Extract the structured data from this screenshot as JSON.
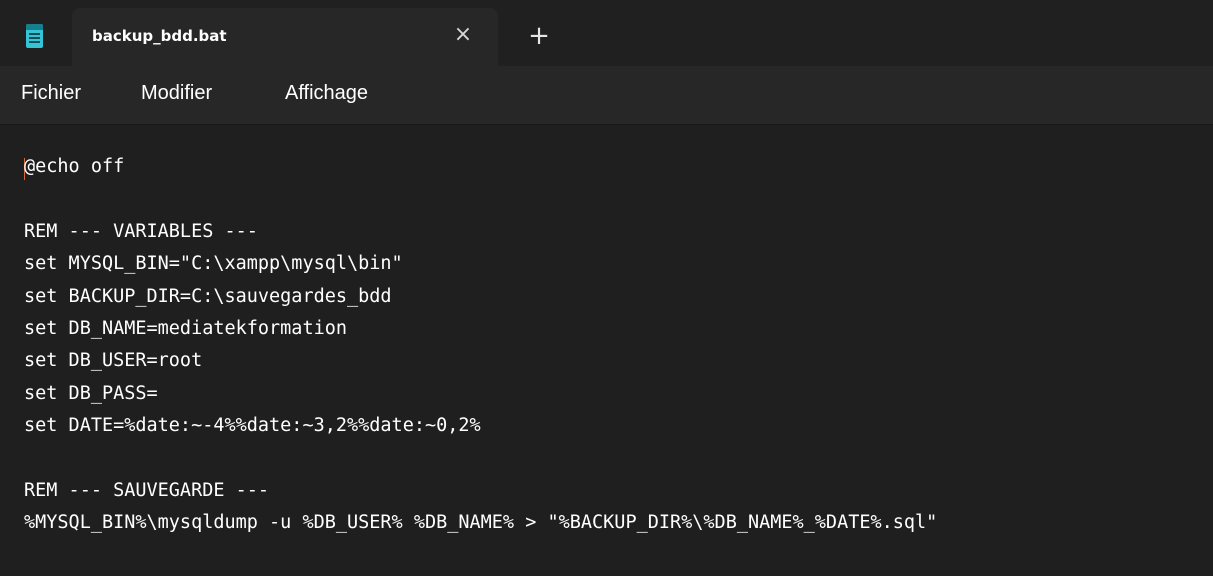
{
  "window": {
    "tab_title": "backup_bdd.bat",
    "close_glyph": "×",
    "new_tab_glyph": "+",
    "app_icon": "notepad-icon",
    "accent_color": "#35c3d6"
  },
  "menu": {
    "items": [
      "Fichier",
      "Modifier",
      "Affichage"
    ]
  },
  "editor": {
    "lines": [
      "@echo off",
      "",
      "REM --- VARIABLES ---",
      "set MYSQL_BIN=\"C:\\xampp\\mysql\\bin\"",
      "set BACKUP_DIR=C:\\sauvegardes_bdd",
      "set DB_NAME=mediatekformation",
      "set DB_USER=root",
      "set DB_PASS=",
      "set DATE=%date:~-4%%date:~3,2%%date:~0,2%",
      "",
      "REM --- SAUVEGARDE ---",
      "%MYSQL_BIN%\\mysqldump -u %DB_USER% %DB_NAME% > \"%BACKUP_DIR%\\%DB_NAME%_%DATE%.sql\""
    ]
  }
}
